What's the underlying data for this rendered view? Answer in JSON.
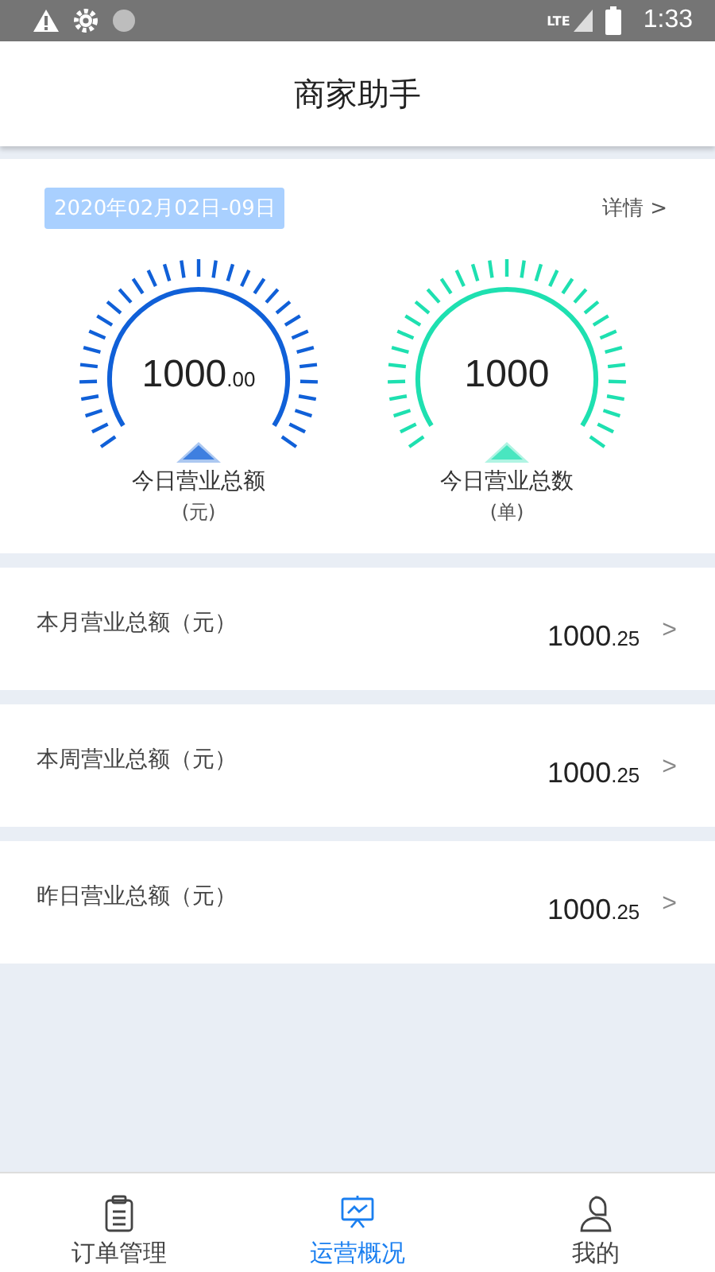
{
  "status_bar": {
    "time": "1:33",
    "network": "LTE"
  },
  "header": {
    "title": "商家助手"
  },
  "summary": {
    "date_range": "2020年02月02日-09日",
    "details_link": "详情 >",
    "gauges": [
      {
        "value": "1000$_{.00}$",
        "label": "今日营业总额",
        "unit": "(元)",
        "color": "#1060d8"
      },
      {
        "value": "1000",
        "label": "今日营业总数",
        "unit": "(单)",
        "color": "#1ee0b0"
      }
    ]
  },
  "rows": [
    {
      "label": "本月营业总额（元）",
      "value": "1000$_{.25}$",
      "arrow": ">"
    },
    {
      "label": "本周营业总额（元）",
      "value": "1000$_{.25}$",
      "arrow": ">"
    },
    {
      "label": "昨日营业总额（元）",
      "value": "1000$_{.25}$",
      "arrow": ">"
    }
  ],
  "tabs": [
    {
      "label": "订单管理",
      "kind": "orders",
      "selected": false
    },
    {
      "label": "运营概况",
      "kind": "overview",
      "selected": true
    },
    {
      "label": "我的",
      "kind": "profile",
      "selected": false
    }
  ]
}
